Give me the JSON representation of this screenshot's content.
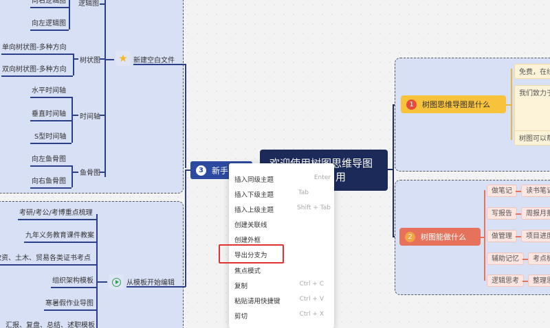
{
  "colors": {
    "accent_navy": "#1c2a5a",
    "blue_node": "#2c4aa0",
    "orange_node": "#f8c23a",
    "salmon_node": "#e7725c",
    "highlight_red": "#e03030"
  },
  "left_top_panel": {
    "branch_label": "新建空白文件",
    "groups": [
      {
        "label": "逻辑图",
        "items": [
          "向右逻辑图",
          "向左逻辑图"
        ]
      },
      {
        "label": "树状图",
        "items": [
          "单向树状图-多种方向",
          "双向树状图-多种方向"
        ]
      },
      {
        "label": "时间轴",
        "items": [
          "水平时间轴",
          "垂直时间轴",
          "S型时间轴"
        ]
      },
      {
        "label": "鱼骨图",
        "items": [
          "向左鱼骨图",
          "向右鱼骨图"
        ]
      }
    ]
  },
  "left_bottom_panel": {
    "branch_label": "从模板开始编辑",
    "items": [
      "考研/考公/考博重点梳理",
      "九年义务教育课件教案",
      "教资、土木、贸易各类证书考点",
      "组织架构模板",
      "寒暑假作业导图",
      "汇报、复盘、总结、述职模板"
    ]
  },
  "center": {
    "title_line1": "欢迎使用树图思维导图",
    "title_line2": "用",
    "new_user_num": "3",
    "new_user_label": "新手"
  },
  "right_top": {
    "num": "1",
    "label": "树图思维导图是什么",
    "boxes": [
      "免费，在线",
      "我们致力于",
      "树图可以帮"
    ]
  },
  "right_bottom": {
    "num": "2",
    "label": "树图能做什么",
    "rows": [
      {
        "a": "做笔记",
        "b": "读书笔记"
      },
      {
        "a": "写报告",
        "b": "周报月报"
      },
      {
        "a": "做管理",
        "b": "项目进度"
      },
      {
        "a": "辅助记忆",
        "b": "考点梳"
      },
      {
        "a": "逻辑思考",
        "b": "整理思"
      }
    ]
  },
  "context_menu": {
    "items": [
      {
        "label": "插入同级主题",
        "shortcut": "Enter"
      },
      {
        "label": "插入下级主题",
        "shortcut": "Tab"
      },
      {
        "label": "插入上级主题",
        "shortcut": "Shift + Tab"
      },
      {
        "label": "创建关联线",
        "shortcut": ""
      },
      {
        "label": "创建外框",
        "shortcut": ""
      },
      {
        "label": "导出分支为",
        "shortcut": ""
      },
      {
        "label": "焦点模式",
        "shortcut": ""
      },
      {
        "label": "复制",
        "shortcut": "Ctrl + C"
      },
      {
        "label": "粘贴请用快捷键",
        "shortcut": "Ctrl + V"
      },
      {
        "label": "剪切",
        "shortcut": "Ctrl + X"
      }
    ]
  }
}
